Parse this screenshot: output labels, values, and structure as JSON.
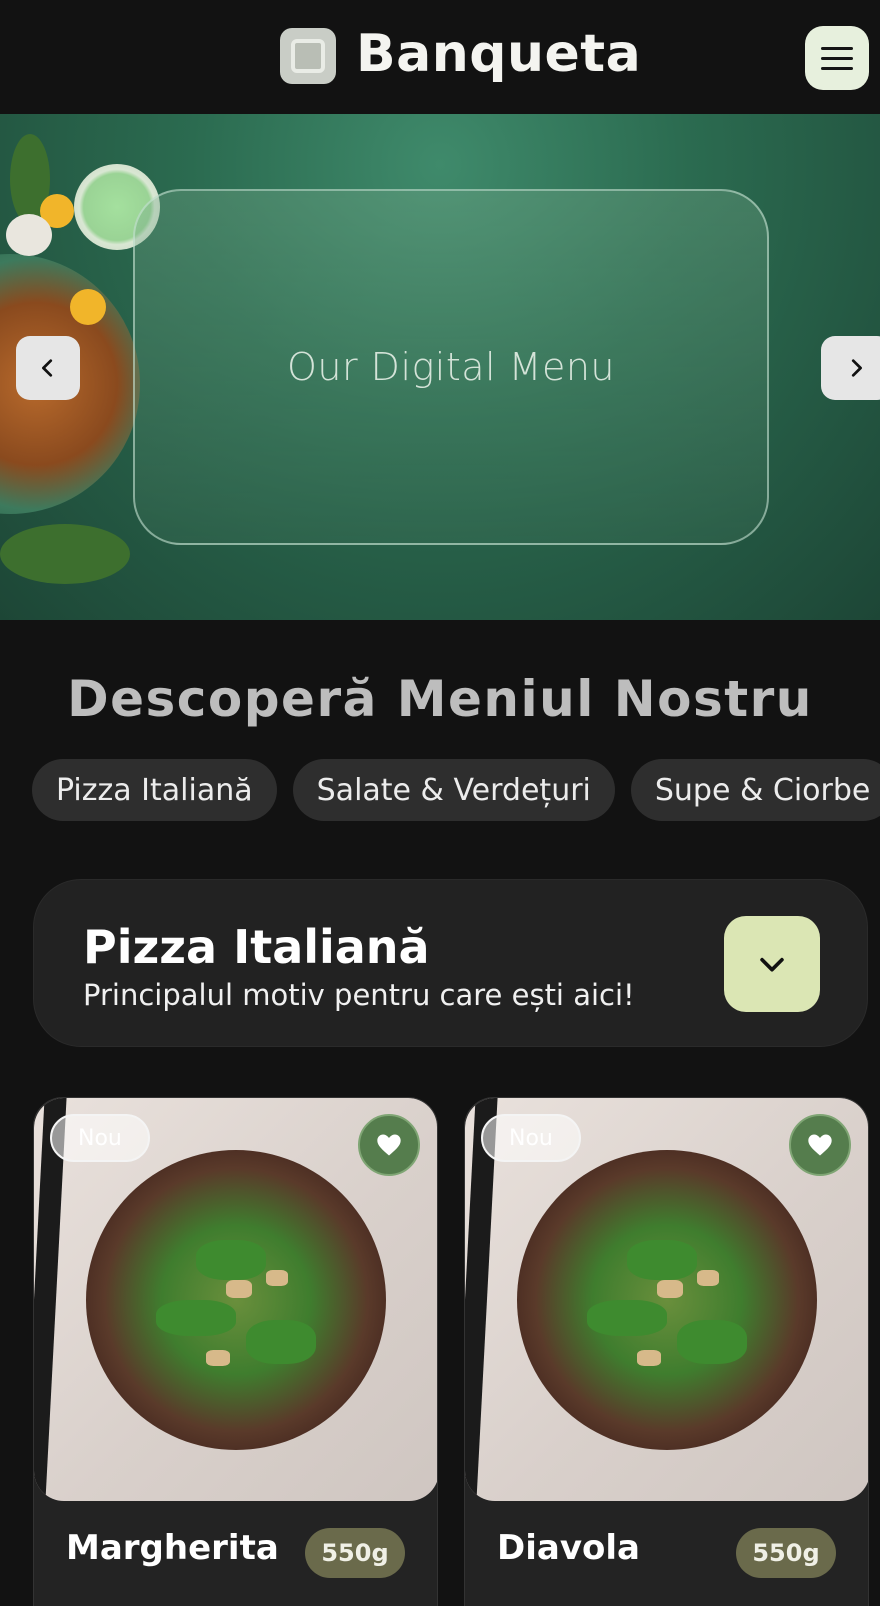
{
  "header": {
    "brand": "Banqueta",
    "logo_icon": "logo-square-icon",
    "menu_icon": "hamburger-icon"
  },
  "hero": {
    "title": "Our Digital Menu",
    "prev_icon": "chevron-left-icon",
    "next_icon": "chevron-right-icon"
  },
  "menu": {
    "section_title": "Descoperă Meniul Nostru",
    "categories": [
      "Pizza Italiană",
      "Salate & Verdețuri",
      "Supe & Ciorbe"
    ]
  },
  "category_card": {
    "title": "Pizza Italiană",
    "subtitle": "Principalul motiv pentru care ești aici!",
    "toggle_icon": "chevron-down-icon"
  },
  "products": [
    {
      "badge": "Nou",
      "name": "Margherita",
      "weight": "550g",
      "fav_icon": "heart-icon"
    },
    {
      "badge": "Nou",
      "name": "Diavola",
      "weight": "550g",
      "fav_icon": "heart-icon"
    }
  ],
  "colors": {
    "background": "#121212",
    "menu_button": "#e7f0dd",
    "accent_toggle": "#dbe6b4",
    "weight_badge": "#6a6a4b",
    "favorite": "#557d4d"
  }
}
